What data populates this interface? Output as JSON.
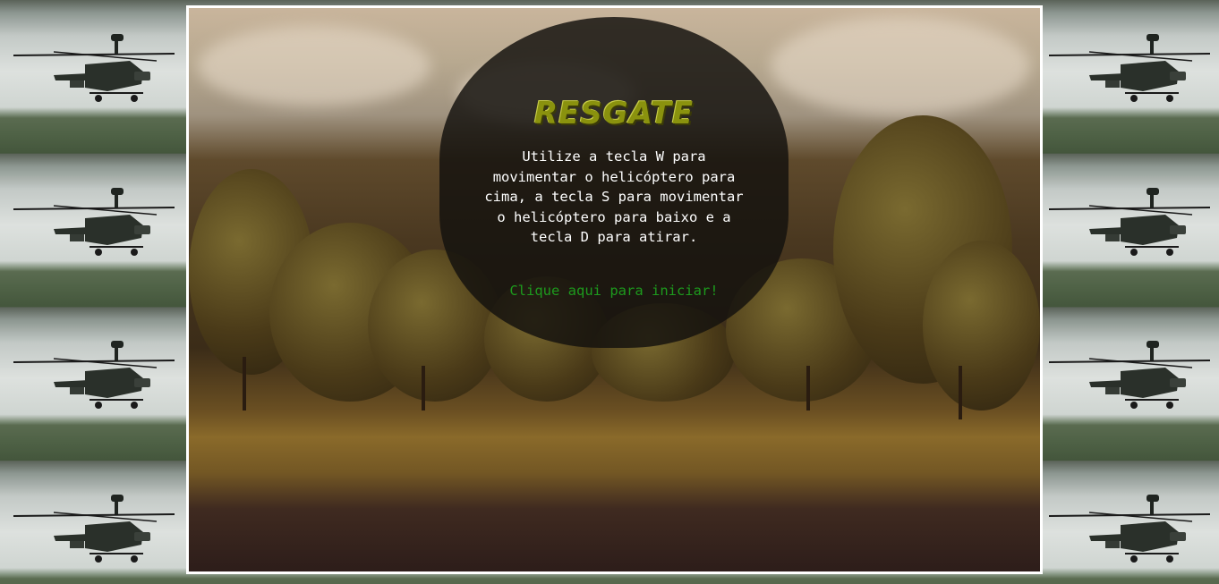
{
  "game": {
    "title": "RESGATE",
    "instructions": "Utilize a tecla W para movimentar o helicóptero para cima, a tecla S para movimentar o helicóptero para baixo e a tecla D para atirar.",
    "start_label": "Clique aqui para iniciar!"
  },
  "colors": {
    "title": "#8a920e",
    "start_link": "#1d9a1d",
    "frame_border": "#ffffff"
  },
  "icons": {
    "background_tile": "helicopter-icon"
  }
}
